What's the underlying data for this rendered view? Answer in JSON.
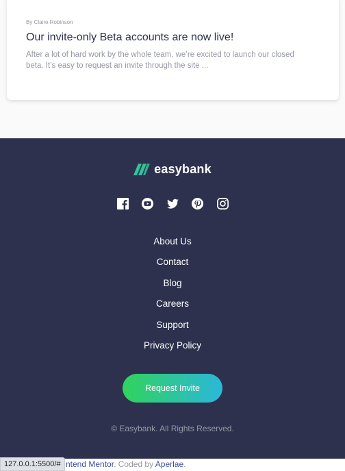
{
  "article": {
    "author": "By Claire Robinson",
    "title": "Our invite-only Beta accounts are now live!",
    "excerpt": "After a lot of hard work by the whole team, we’re excited to launch our closed beta. It’s easy to request an invite through the site ..."
  },
  "footer": {
    "logo_text": "easybank",
    "social_icons": [
      "facebook-icon",
      "youtube-icon",
      "twitter-icon",
      "pinterest-icon",
      "instagram-icon"
    ],
    "links": [
      "About Us",
      "Contact",
      "Blog",
      "Careers",
      "Support",
      "Privacy Policy"
    ],
    "cta_label": "Request Invite",
    "copyright": "© Easybank. All Rights Reserved."
  },
  "attribution": {
    "prefix": "ntend Mentor",
    "mid": ". Coded by ",
    "author": "Aperlae",
    "suffix": "."
  },
  "status_bar": {
    "url": "127.0.0.1:5500/#"
  },
  "colors": {
    "footer_bg": "#2d314d",
    "text_dark": "#2d314d",
    "text_muted": "#9698a6",
    "gradient_start": "#31d35c",
    "gradient_end": "#2bb7da",
    "link_accent": "#3e52a3"
  }
}
